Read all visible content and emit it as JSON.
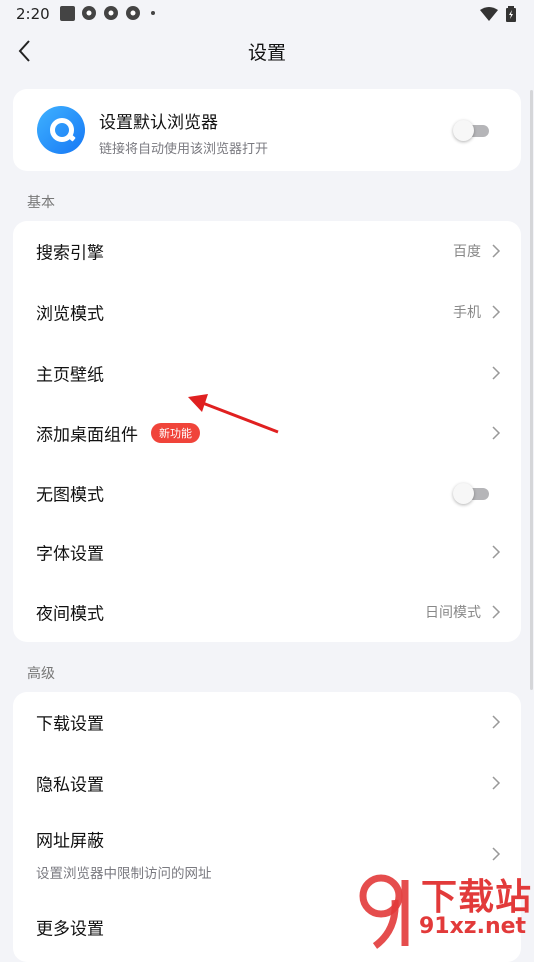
{
  "status_bar": {
    "time": "2:20"
  },
  "header": {
    "title": "设置"
  },
  "default_browser": {
    "title": "设置默认浏览器",
    "subtitle": "链接将自动使用该浏览器打开",
    "enabled": false
  },
  "basic_section": {
    "label": "基本",
    "items": [
      {
        "label": "搜索引擎",
        "value": "百度"
      },
      {
        "label": "浏览模式",
        "value": "手机"
      },
      {
        "label": "主页壁纸",
        "value": ""
      },
      {
        "label": "添加桌面组件",
        "value": "",
        "badge": "新功能"
      },
      {
        "label": "无图模式",
        "toggle": false
      },
      {
        "label": "字体设置",
        "value": ""
      },
      {
        "label": "夜间模式",
        "value": "日间模式"
      }
    ]
  },
  "advanced_section": {
    "label": "高级",
    "items": [
      {
        "label": "下载设置"
      },
      {
        "label": "隐私设置"
      },
      {
        "label": "网址屏蔽",
        "subtitle": "设置浏览器中限制访问的网址"
      },
      {
        "label": "更多设置"
      }
    ]
  },
  "watermark": {
    "text_main": "下载站",
    "text_domain": "91xz.net"
  },
  "colors": {
    "accent": "#1677f5",
    "badge": "#f0443a",
    "annotation_arrow": "#e02020"
  }
}
